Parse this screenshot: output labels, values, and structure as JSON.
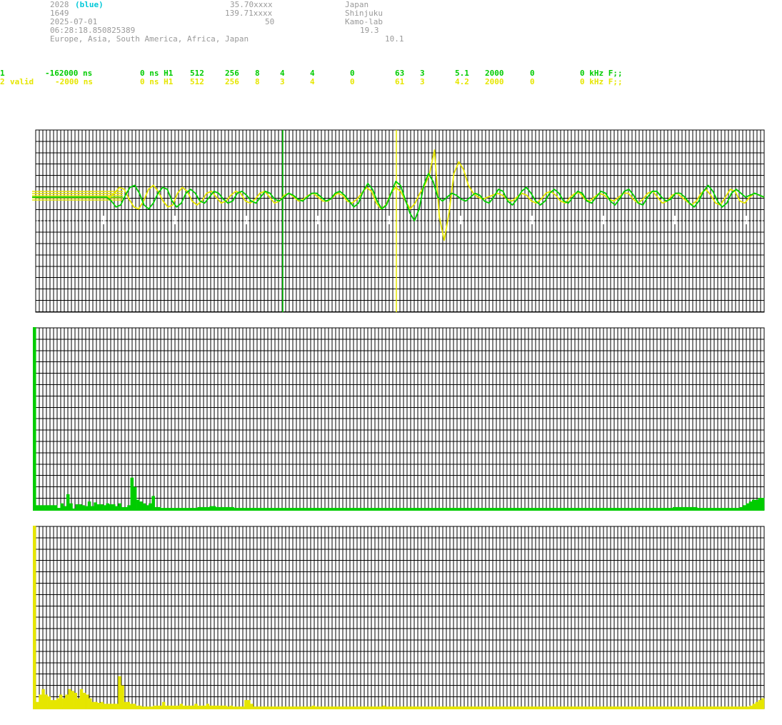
{
  "header": {
    "col1": {
      "line1_num": "2028",
      "line1_tag": "(blue)",
      "line2": "1649",
      "line3": "2025-07-01",
      "line4": "06:28:18.850825389",
      "line5": "Europe, Asia, South America, Africa, Japan"
    },
    "col2": {
      "line1": "35.70xxxx",
      "line2": "139.71xxxx",
      "line3": "50"
    },
    "col3": {
      "line1": "Japan",
      "line2": "Shinjuku",
      "line3": "Kamo-lab",
      "line4": "19.3",
      "line5": "10.1"
    }
  },
  "channels": [
    {
      "id": "1",
      "status": "",
      "offset": "-162000 ns",
      "delay": "0 ns H1",
      "n1": "512",
      "n2": "256",
      "n3": "8",
      "n4": "4",
      "n5": "4",
      "n6": "0",
      "n7": "63",
      "n8": "3",
      "n9": "5.1",
      "n10": "2000",
      "n11": "0",
      "unit": "0 kHz F;;",
      "color": "#00cc00"
    },
    {
      "id": "2",
      "status": "valid",
      "offset": "-2000 ns",
      "delay": "0 ns H1",
      "n1": "512",
      "n2": "256",
      "n3": "8",
      "n4": "3",
      "n5": "4",
      "n6": "0",
      "n7": "61",
      "n8": "3",
      "n9": "4.2",
      "n10": "2000",
      "n11": "0",
      "unit": "0 kHz F;;",
      "color": "#e6e600"
    }
  ],
  "colors": {
    "grid": "#000000",
    "ch1": "#00cc00",
    "ch2": "#e6e600",
    "tick": "#ffffff"
  },
  "chart_data": [
    {
      "type": "line",
      "series": [
        {
          "values": [
            0,
            0,
            0,
            0,
            0,
            0,
            0,
            0,
            0,
            0,
            0,
            0,
            0,
            0,
            0,
            0,
            0,
            -0.1,
            -0.25,
            -0.2,
            0.05,
            0.25,
            0.3,
            0.1,
            -0.2,
            -0.3,
            -0.15,
            0.1,
            0.25,
            0.2,
            -0.1,
            -0.25,
            -0.15,
            0.1,
            0.2,
            0.1,
            -0.1,
            -0.15,
            0,
            0.15,
            0.1,
            -0.05,
            -0.15,
            -0.1,
            0.1,
            0.15,
            0.05,
            -0.1,
            -0.15,
            0,
            0.15,
            0.1,
            -0.05,
            -0.1,
            0,
            0.1,
            0.05,
            -0.05,
            -0.1,
            0,
            0.1,
            0.1,
            0,
            -0.1,
            -0.05,
            0.1,
            0.15,
            0.05,
            -0.1,
            -0.25,
            -0.15,
            0.15,
            0.35,
            0.2,
            -0.1,
            -0.3,
            -0.2,
            0.1,
            0.4,
            0.3,
            -0.05,
            -0.4,
            -0.6,
            -0.3,
            0.3,
            0.6,
            0.4,
            0,
            -0.1,
            0,
            0.1,
            0.05,
            -0.05,
            -0.1,
            0,
            0.1,
            0.05,
            -0.1,
            -0.15,
            0,
            0.2,
            0.15,
            -0.1,
            -0.2,
            -0.05,
            0.15,
            0.25,
            0.1,
            -0.1,
            -0.2,
            -0.1,
            0.1,
            0.2,
            0.1,
            -0.1,
            -0.15,
            0,
            0.15,
            0.1,
            -0.1,
            -0.15,
            0,
            0.15,
            0.1,
            -0.1,
            -0.2,
            -0.05,
            0.15,
            0.2,
            0.05,
            -0.15,
            -0.2,
            0,
            0.15,
            0.15,
            0,
            -0.1,
            -0.05,
            0.1,
            0.1,
            0,
            -0.15,
            -0.25,
            -0.1,
            0.15,
            0.3,
            0.15,
            -0.1,
            -0.25,
            -0.15,
            0.1,
            0.2,
            0.1,
            0,
            0.05,
            0.1,
            0.05,
            0
          ]
        },
        {
          "values": [
            0,
            0,
            0,
            0,
            0,
            0,
            0,
            0,
            0,
            0,
            0,
            0,
            0,
            0,
            0,
            0,
            0,
            0.1,
            0.25,
            0.2,
            -0.05,
            -0.25,
            -0.3,
            -0.1,
            0.2,
            0.3,
            0.15,
            -0.1,
            -0.25,
            -0.2,
            0.1,
            0.25,
            0.15,
            -0.1,
            -0.2,
            -0.1,
            0.1,
            0.15,
            0,
            -0.15,
            -0.1,
            0.05,
            0.15,
            0.1,
            -0.1,
            -0.15,
            -0.05,
            0.1,
            0.15,
            0,
            -0.15,
            -0.1,
            0.05,
            0.1,
            0,
            -0.1,
            -0.05,
            0.05,
            0.1,
            0,
            -0.1,
            -0.1,
            0,
            0.1,
            0.05,
            -0.1,
            -0.15,
            -0.05,
            0.1,
            0.25,
            0.15,
            -0.15,
            -0.3,
            -0.2,
            0.1,
            0.25,
            0.15,
            -0.1,
            -0.3,
            -0.15,
            0.1,
            0.3,
            0.6,
            1.2,
            -0.5,
            -1.1,
            -0.4,
            0.6,
            0.9,
            0.7,
            0.3,
            0.1,
            0,
            -0.05,
            0,
            0.05,
            0.1,
            0.05,
            -0.05,
            -0.1,
            0,
            0.1,
            0.05,
            -0.1,
            -0.15,
            -0.05,
            0.1,
            0.15,
            0.05,
            -0.1,
            -0.15,
            0,
            0.1,
            0.1,
            -0.05,
            -0.1,
            0,
            0.1,
            0.05,
            -0.05,
            -0.1,
            0,
            0.1,
            0.1,
            -0.05,
            -0.15,
            -0.05,
            0.1,
            0.15,
            0,
            -0.15,
            -0.1,
            0.05,
            0.1,
            0,
            -0.1,
            -0.2,
            -0.1,
            0.1,
            0.2,
            0.05,
            -0.15,
            -0.2,
            0,
            0.2,
            0.15,
            -0.1,
            -0.15,
            0,
            0.1,
            0.05,
            0
          ]
        }
      ]
    },
    {
      "type": "bar",
      "values": [
        100,
        3,
        3,
        3,
        3,
        3,
        3,
        3,
        1.5,
        4,
        2.5,
        9,
        4,
        1.2,
        3.5,
        3.5,
        3,
        2.5,
        5,
        2.5,
        4.5,
        3.5,
        3.5,
        3,
        4,
        3.5,
        3.5,
        2.5,
        4,
        2,
        2,
        3,
        18,
        13,
        6,
        5,
        4,
        3,
        4,
        8,
        2,
        2,
        1.5,
        1.5,
        1.5,
        1.5,
        1.5,
        1.5,
        1.5,
        1.5,
        1.5,
        1.5,
        1.5,
        1.5,
        2,
        2,
        2,
        2,
        2.5,
        2.5,
        2,
        2,
        2,
        2,
        2,
        2,
        1.5,
        1.5,
        1.5,
        1.5,
        1.5,
        1.5,
        1.5,
        1.5,
        1.5,
        1.5,
        1.5,
        1.5,
        1.5,
        1.5,
        1.5,
        1.5,
        1.5,
        1.5,
        1.5,
        1.5,
        1.5,
        1.5,
        1.5,
        1.5,
        1.5,
        1.5,
        1.5,
        1.5,
        1.5,
        1.5,
        1.5,
        1.5,
        1.5,
        1.5,
        1.5,
        1.5,
        1.5,
        1.5,
        1.5,
        1.5,
        1.5,
        1.5,
        1.5,
        1.5,
        1.5,
        1.5,
        1.5,
        1.5,
        1.5,
        1.5,
        1.5,
        1.5,
        1.5,
        1.5,
        1.5,
        1.5,
        1.5,
        1.5,
        1.5,
        1.5,
        1.5,
        1.5,
        1.5,
        1.5,
        1.5,
        1.5,
        1.5,
        1.5,
        1.5,
        1.5,
        1.5,
        1.5,
        1.5,
        1.5,
        1.5,
        1.5,
        1.5,
        1.5,
        1.5,
        1.5,
        1.5,
        1.5,
        1.5,
        1.5,
        1.5,
        1.5,
        1.5,
        1.5,
        1.5,
        1.5,
        1.5,
        1.5,
        1.5,
        1.5,
        1.5,
        1.5,
        1.5,
        1.5,
        1.5,
        1.5,
        1.5,
        1.5,
        1.5,
        1.5,
        1.5,
        1.5,
        1.5,
        1.5,
        1.5,
        1.5,
        1.5,
        1.5,
        1.5,
        1.5,
        1.5,
        1.5,
        1.5,
        1.5,
        1.5,
        1.5,
        1.5,
        1.5,
        1.5,
        1.5,
        1.5,
        1.5,
        1.5,
        1.5,
        1.5,
        1.5,
        1.5,
        1.5,
        1.5,
        1.5,
        1.5,
        1.5,
        1.5,
        1.5,
        1.5,
        1.5,
        1.5,
        1.5,
        1.5,
        1.5,
        2,
        2,
        2,
        2,
        2,
        2,
        2,
        2,
        1.5,
        1.5,
        1.5,
        1.5,
        1.5,
        1.5,
        1.5,
        1.5,
        1.5,
        1.5,
        1.5,
        1.5,
        1.5,
        1.5,
        2,
        3,
        4,
        5,
        6,
        6,
        7,
        7
      ]
    },
    {
      "type": "bar",
      "values": [
        100,
        4,
        8,
        11,
        8,
        7,
        5,
        5,
        6,
        8,
        6,
        8,
        11,
        10,
        9,
        6,
        11,
        9,
        8,
        6,
        4,
        4,
        3.5,
        4,
        3,
        3,
        3,
        3,
        3,
        18,
        13,
        4,
        4,
        3,
        3,
        2,
        2,
        1.5,
        1.5,
        1.5,
        1.5,
        2,
        2,
        2,
        4,
        2,
        2,
        2,
        2,
        2,
        3,
        2,
        2,
        2,
        2,
        3,
        2,
        2,
        2,
        3,
        2,
        2,
        2,
        2,
        2,
        2,
        1.5,
        2,
        1.5,
        1.5,
        1.5,
        1.5,
        5,
        5,
        3,
        1.5,
        1.5,
        1.5,
        1.5,
        1.5,
        1.5,
        1.5,
        1.5,
        1.5,
        1.5,
        1.5,
        1.5,
        1.5,
        1.5,
        1.5,
        1.5,
        1.5,
        1.5,
        1.5,
        1.5,
        2,
        1.5,
        1.5,
        1.5,
        1.5,
        1.5,
        1.5,
        1.5,
        1.5,
        1.5,
        1.5,
        1.5,
        1.5,
        1.5,
        1.5,
        1.5,
        1.5,
        1.5,
        1.5,
        1.5,
        1.5,
        1.5,
        1.5,
        1.5,
        2,
        1.5,
        1.5,
        1.5,
        1.5,
        1.5,
        1.5,
        1.5,
        1.5,
        1.5,
        1.5,
        1.5,
        1.5,
        1.5,
        1.5,
        1.5,
        1.5,
        1.5,
        1.5,
        1.5,
        1.5,
        1.5,
        1.5,
        1.5,
        1.5,
        1.5,
        1.5,
        1.5,
        1.5,
        1.5,
        1.5,
        1.5,
        1.5,
        1.5,
        1.5,
        1.5,
        1.5,
        1.5,
        1.5,
        1.5,
        1.5,
        1.5,
        1.5,
        1.5,
        1.5,
        1.5,
        1.5,
        1.5,
        1.5,
        1.5,
        1.5,
        1.5,
        1.5,
        1.5,
        1.5,
        1.5,
        1.5,
        1.5,
        1.5,
        1.5,
        1.5,
        1.5,
        1.5,
        1.5,
        1.5,
        1.5,
        1.5,
        1.5,
        1.5,
        1.5,
        1.5,
        1.5,
        1.5,
        1.5,
        1.5,
        1.5,
        1.5,
        1.5,
        1.5,
        1.5,
        1.5,
        1.5,
        1.5,
        1.5,
        1.5,
        1.5,
        1.5,
        1.5,
        1.5,
        1.5,
        1.5,
        1.5,
        1.5,
        1.5,
        1.5,
        1.5,
        1.5,
        1.5,
        1.5,
        1.5,
        1.5,
        1.5,
        1.5,
        1.5,
        1.5,
        1.5,
        1.5,
        1.5,
        1.5,
        1.5,
        1.5,
        1.5,
        1.5,
        1.5,
        1.5,
        1.5,
        1.5,
        1.5,
        1.5,
        1.5,
        1.5,
        1.5,
        1.5,
        1.5,
        1.5,
        2,
        3,
        4,
        5,
        6
      ]
    }
  ]
}
